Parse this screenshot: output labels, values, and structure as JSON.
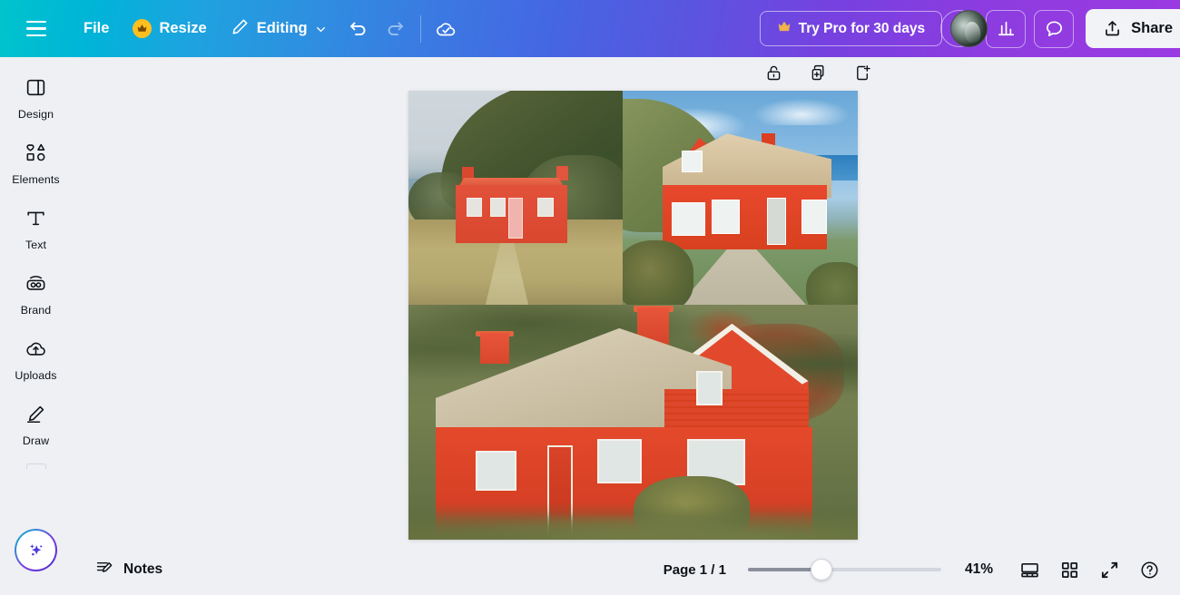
{
  "topbar": {
    "menu_icon": "hamburger-icon",
    "file_label": "File",
    "resize_label": "Resize",
    "resize_icon": "crown-icon",
    "editing_label": "Editing",
    "editing_icon": "pencil-icon",
    "editing_chevron": "chevron-down-icon",
    "undo_icon": "undo-icon",
    "redo_icon": "redo-icon",
    "saved_icon": "cloud-check-icon",
    "try_pro_label": "Try Pro for 30 days",
    "try_pro_icon": "crown-icon",
    "avatar": "user-avatar",
    "add_collaborator_icon": "plus-icon",
    "insights_icon": "bar-chart-icon",
    "comments_icon": "speech-bubble-icon",
    "share_label": "Share",
    "share_icon": "upload-icon"
  },
  "sidebar": {
    "items": [
      {
        "label": "Design",
        "icon": "design-panel-icon"
      },
      {
        "label": "Elements",
        "icon": "shapes-icon"
      },
      {
        "label": "Text",
        "icon": "text-t-icon"
      },
      {
        "label": "Brand",
        "icon": "brand-co-icon"
      },
      {
        "label": "Uploads",
        "icon": "cloud-upload-icon"
      },
      {
        "label": "Draw",
        "icon": "draw-pen-icon"
      }
    ],
    "magic_button_icon": "sparkle-icon"
  },
  "canvas": {
    "page_tools": [
      {
        "name": "lock-page",
        "icon": "lock-icon"
      },
      {
        "name": "duplicate-page",
        "icon": "duplicate-icon"
      },
      {
        "name": "add-page",
        "icon": "add-page-icon"
      }
    ],
    "design": {
      "title": "Red cottage photo grid",
      "layout": "2-up top row, 1 full-width bottom",
      "images": [
        {
          "name": "red-cottage-by-the-sea",
          "alt": "Small red cottage with red tin roof beside the sea, green hill behind, dry golden grass in front"
        },
        {
          "name": "red-house-thatched-roof-path",
          "alt": "Red house with pale thatched roof and white windows, gravel path, blue sky and sea"
        },
        {
          "name": "large-red-thatched-cottage",
          "alt": "Large red timber cottage with thatched roof and two red chimneys on heathland"
        }
      ]
    }
  },
  "bottombar": {
    "notes_label": "Notes",
    "notes_icon": "notes-pencil-icon",
    "page_label": "Page 1 / 1",
    "zoom_value": "41%",
    "zoom_percent": 41,
    "slider_position_percent": 38,
    "icons": [
      {
        "name": "presentation-view",
        "icon": "presentation-icon"
      },
      {
        "name": "grid-view",
        "icon": "grid-icon"
      },
      {
        "name": "fullscreen",
        "icon": "expand-icon"
      },
      {
        "name": "help",
        "icon": "question-circle-icon"
      }
    ]
  },
  "colors": {
    "brand_teal": "#00c4cc",
    "brand_blue": "#4566e3",
    "brand_purple": "#9b3ae2",
    "app_background": "#eef0f4",
    "text_primary": "#0e1318"
  }
}
